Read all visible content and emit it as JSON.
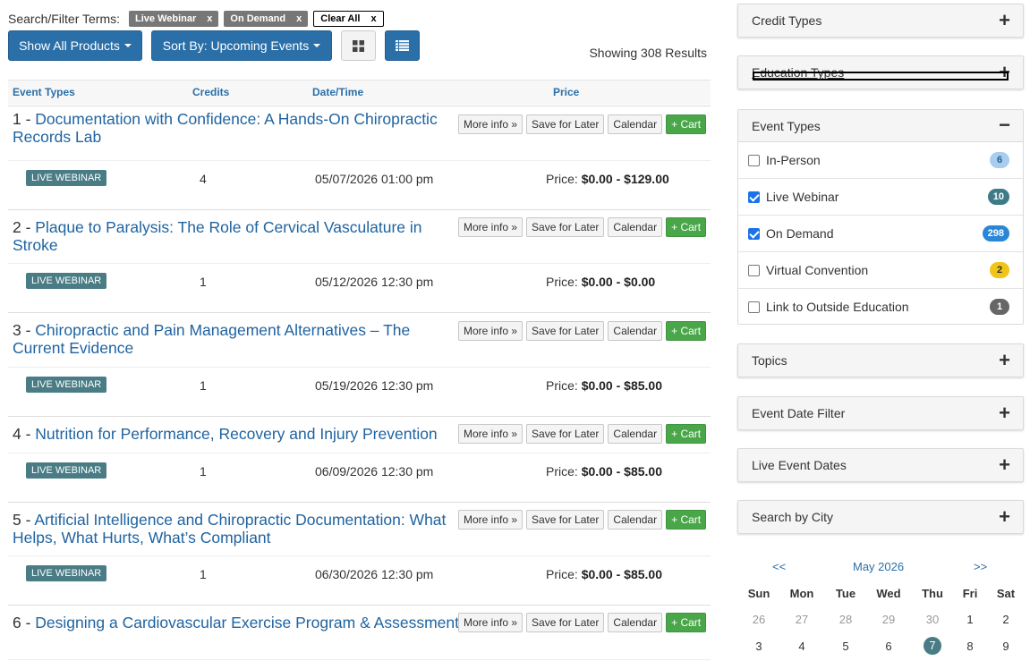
{
  "filter_bar": {
    "label": "Search/Filter Terms:",
    "chips": [
      {
        "label": "Live Webinar",
        "remove": "x"
      },
      {
        "label": "On Demand",
        "remove": "x"
      }
    ],
    "clear_all": {
      "label": "Clear All",
      "remove": "x"
    }
  },
  "toolbar": {
    "show_products_label": "Show All Products",
    "sort_label": "Sort By: Upcoming Events",
    "results_text": "Showing 308 Results"
  },
  "table_headers": {
    "event_types": "Event Types",
    "credits": "Credits",
    "date_time": "Date/Time",
    "price": "Price"
  },
  "event_buttons": {
    "more_info": "More info »",
    "save_later": "Save for Later",
    "calendar": "Calendar",
    "cart": "+ Cart"
  },
  "events": [
    {
      "num": "1 - ",
      "title": "Documentation with Confidence: A Hands-On Chiropractic Records Lab",
      "badge": "LIVE WEBINAR",
      "credits": "4",
      "datetime": "05/07/2026 01:00 pm",
      "price_label": "Price: ",
      "price": "$0.00 - $129.00"
    },
    {
      "num": "2 - ",
      "title": "Plaque to Paralysis: The Role of Cervical Vasculature in Stroke",
      "badge": "LIVE WEBINAR",
      "credits": "1",
      "datetime": "05/12/2026 12:30 pm",
      "price_label": "Price: ",
      "price": "$0.00 - $0.00"
    },
    {
      "num": "3 - ",
      "title": "Chiropractic and Pain Management Alternatives – The Current Evidence",
      "badge": "LIVE WEBINAR",
      "credits": "1",
      "datetime": "05/19/2026 12:30 pm",
      "price_label": "Price: ",
      "price": "$0.00 - $85.00"
    },
    {
      "num": "4 - ",
      "title": "Nutrition for Performance, Recovery and Injury Prevention",
      "badge": "LIVE WEBINAR",
      "credits": "1",
      "datetime": "06/09/2026 12:30 pm",
      "price_label": "Price: ",
      "price": "$0.00 - $85.00"
    },
    {
      "num": "5 - ",
      "title": "Artificial Intelligence and Chiropractic Documentation: What Helps, What Hurts, What’s Compliant",
      "badge": "LIVE WEBINAR",
      "credits": "1",
      "datetime": "06/30/2026 12:30 pm",
      "price_label": "Price: ",
      "price": "$0.00 - $85.00"
    },
    {
      "num": "6 - ",
      "title": "Designing a Cardiovascular Exercise Program & Assessment"
    }
  ],
  "sidebar": {
    "credit_types": {
      "title": "Credit Types",
      "toggle": "+"
    },
    "education_types": {
      "title": "Education Types",
      "toggle": "+"
    },
    "event_types": {
      "title": "Event Types",
      "toggle": "−",
      "items": [
        {
          "label": "In-Person",
          "count": "6",
          "checked": false,
          "badge_color": "#a8cdef",
          "badge_text_color": "#2a5d8a"
        },
        {
          "label": "Live Webinar",
          "count": "10",
          "checked": true,
          "badge_color": "#3e7b88",
          "badge_text_color": "#ffffff"
        },
        {
          "label": "On Demand",
          "count": "298",
          "checked": true,
          "badge_color": "#2a86d6",
          "badge_text_color": "#ffffff"
        },
        {
          "label": "Virtual Convention",
          "count": "2",
          "checked": false,
          "badge_color": "#f0c419",
          "badge_text_color": "#333333"
        },
        {
          "label": "Link to Outside Education",
          "count": "1",
          "checked": false,
          "badge_color": "#666666",
          "badge_text_color": "#ffffff"
        }
      ]
    },
    "topics": {
      "title": "Topics",
      "toggle": "+"
    },
    "event_date_filter": {
      "title": "Event Date Filter",
      "toggle": "+"
    },
    "live_event_dates": {
      "title": "Live Event Dates",
      "toggle": "+"
    },
    "search_by_city": {
      "title": "Search by City",
      "toggle": "+"
    }
  },
  "calendar": {
    "prev": "<<",
    "next": ">>",
    "month": "May 2026",
    "days_of_week": [
      "Sun",
      "Mon",
      "Tue",
      "Wed",
      "Thu",
      "Fri",
      "Sat"
    ],
    "weeks": [
      [
        "26",
        "27",
        "28",
        "29",
        "30",
        "1",
        "2"
      ],
      [
        "3",
        "4",
        "5",
        "6",
        "7",
        "8",
        "9"
      ]
    ],
    "muted_days": [
      "26",
      "27",
      "28",
      "29",
      "30"
    ],
    "today": "7"
  }
}
